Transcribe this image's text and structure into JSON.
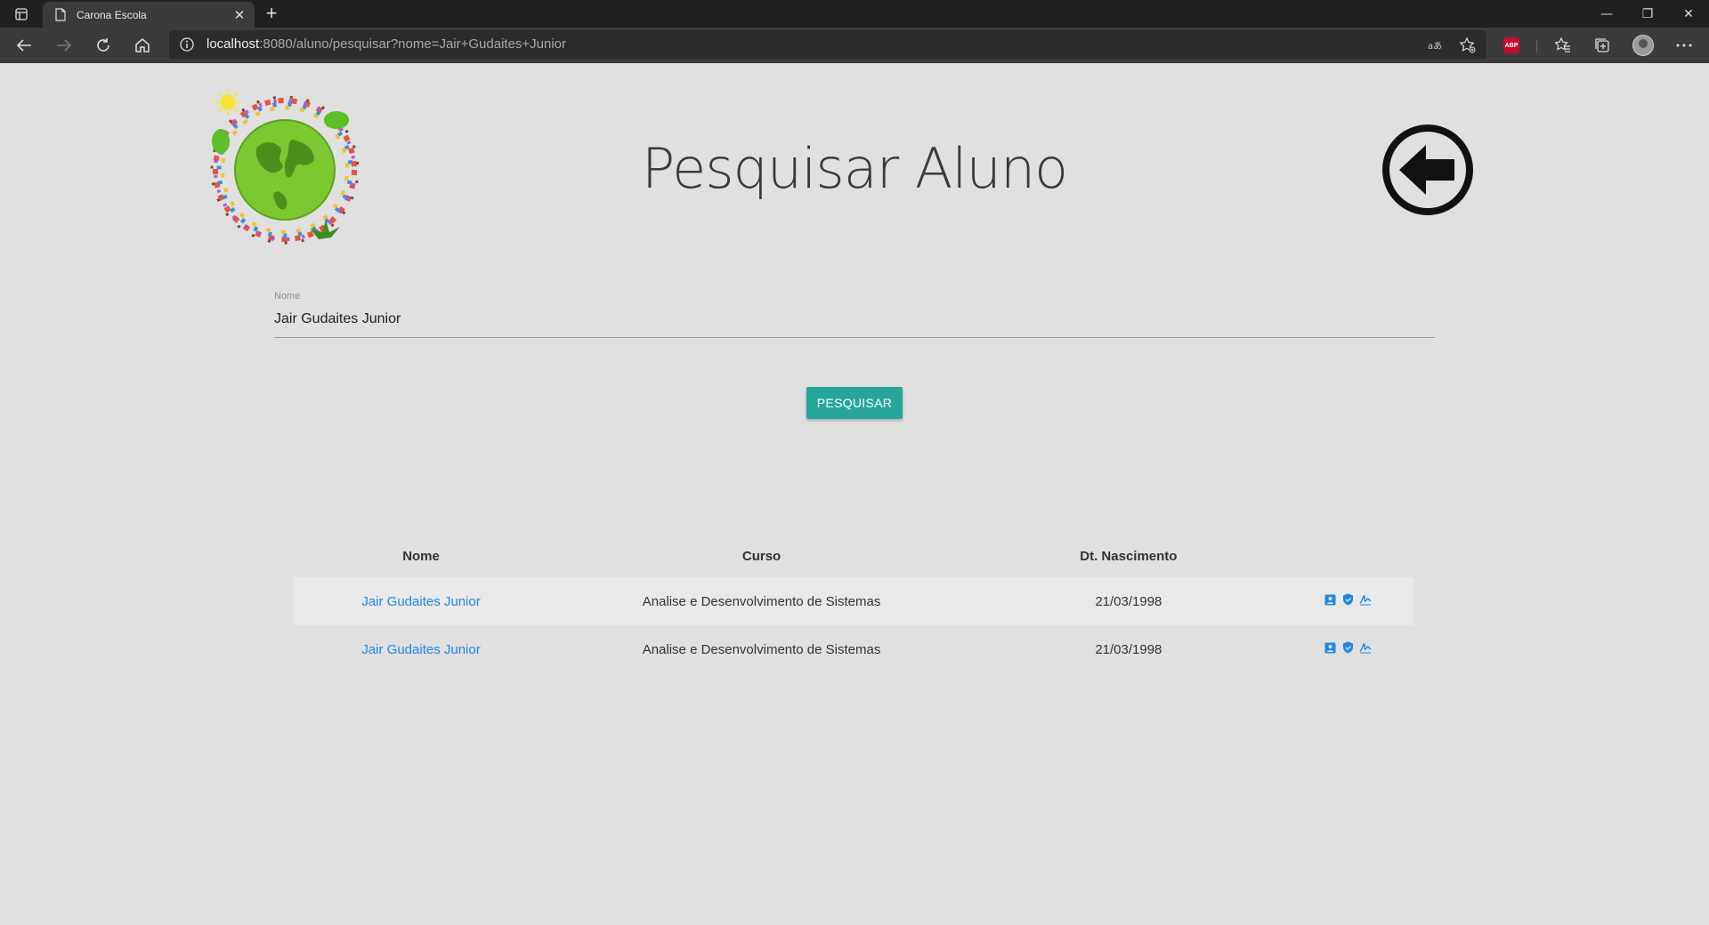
{
  "browser": {
    "tab_title": "Carona Escola",
    "url_host": "localhost",
    "url_rest": ":8080/aluno/pesquisar?nome=Jair+Gudaites+Junior",
    "adblock_label": "ABP",
    "new_tab": "+",
    "window_controls": {
      "minimize": "—",
      "restore": "❐",
      "close": "✕"
    }
  },
  "page": {
    "title": "Pesquisar Aluno",
    "search": {
      "label": "Nome",
      "value": "Jair Gudaites Junior",
      "button_label": "PESQUISAR"
    },
    "table": {
      "headers": [
        "Nome",
        "Curso",
        "Dt. Nascimento",
        ""
      ],
      "rows": [
        {
          "nome": "Jair Gudaites Junior",
          "curso": "Analise e Desenvolvimento de Sistemas",
          "nascimento": "21/03/1998",
          "actions": [
            "contact-card-icon",
            "shield-check-icon",
            "signature-icon"
          ]
        },
        {
          "nome": "Jair Gudaites Junior",
          "curso": "Analise e Desenvolvimento de Sistemas",
          "nascimento": "21/03/1998",
          "actions": [
            "contact-card-icon",
            "shield-check-icon",
            "signature-icon"
          ]
        }
      ]
    }
  },
  "colors": {
    "page_background": "#e0e0e0",
    "primary_button": "#26a69a",
    "link": "#1e88e5",
    "row_stripe": "#e9e9e9",
    "browser_dark": "#202020",
    "browser_toolbar": "#3b3b3b"
  }
}
